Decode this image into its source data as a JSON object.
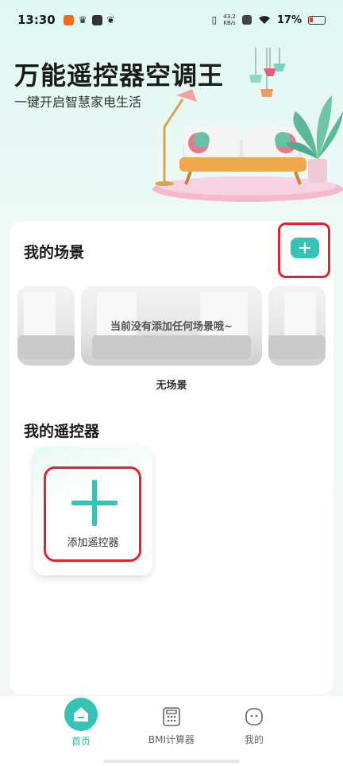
{
  "status_bar": {
    "time": "13:30",
    "net_speed_value": "43.2",
    "net_speed_unit": "KB/s",
    "battery": "17%"
  },
  "header": {
    "title": "万能遥控器空调王",
    "subtitle": "一键开启智慧家电生活"
  },
  "scenes": {
    "title": "我的场景",
    "empty_text": "当前没有添加任何场景哦~",
    "caption": "无场景",
    "add_button_icon": "plus-icon"
  },
  "remotes": {
    "title": "我的遥控器",
    "add_label": "添加遥控器"
  },
  "nav": {
    "items": [
      {
        "label": "首页",
        "icon": "home-icon",
        "active": true
      },
      {
        "label": "BMI计算器",
        "icon": "calculator-icon",
        "active": false
      },
      {
        "label": "我的",
        "icon": "profile-face-icon",
        "active": false
      }
    ]
  },
  "colors": {
    "accent": "#36c3b5",
    "highlight_box": "#e0232e"
  }
}
